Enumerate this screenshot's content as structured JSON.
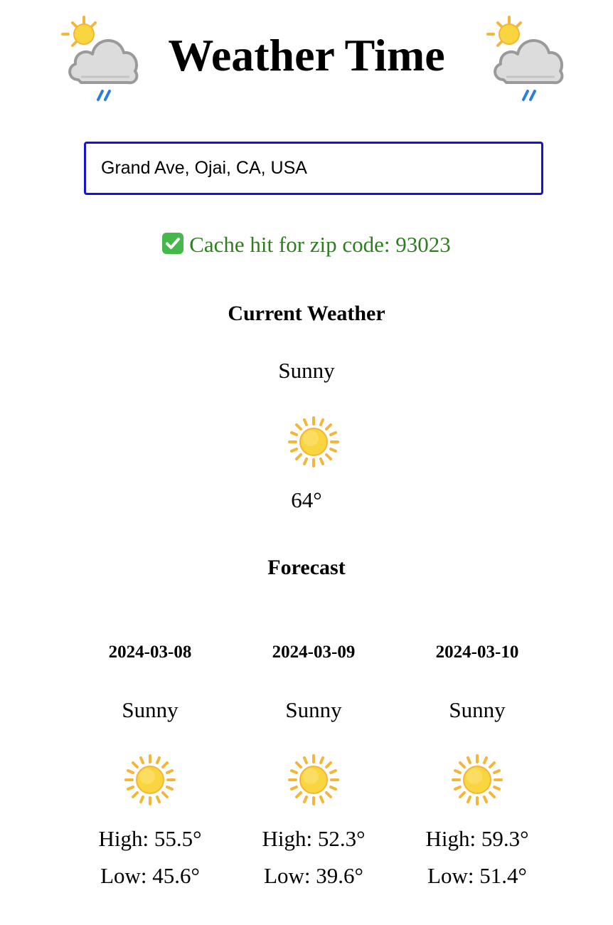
{
  "app": {
    "title": "Weather Time",
    "header_icon": "sun-behind-rain-cloud-icon"
  },
  "search": {
    "value": "Grand Ave, Ojai, CA, USA",
    "placeholder": ""
  },
  "status": {
    "icon": "check-mark-icon",
    "text": "Cache hit for zip code: 93023",
    "color": "#2e7d1e"
  },
  "current": {
    "heading": "Current Weather",
    "condition": "Sunny",
    "icon": "sun-icon",
    "temperature": "64°"
  },
  "forecast": {
    "heading": "Forecast",
    "days": [
      {
        "date": "2024-03-08",
        "condition": "Sunny",
        "icon": "sun-icon",
        "high": "High: 55.5°",
        "low": "Low: 45.6°"
      },
      {
        "date": "2024-03-09",
        "condition": "Sunny",
        "icon": "sun-icon",
        "high": "High: 52.3°",
        "low": "Low: 39.6°"
      },
      {
        "date": "2024-03-10",
        "condition": "Sunny",
        "icon": "sun-icon",
        "high": "High: 59.3°",
        "low": "Low: 51.4°"
      }
    ]
  },
  "colors": {
    "input_border": "#1a12d2",
    "status_text": "#2e7d1e",
    "sun": "#f7c531"
  }
}
